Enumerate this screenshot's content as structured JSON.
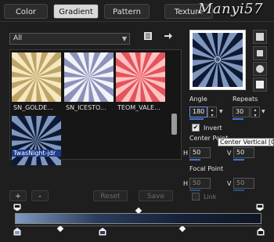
{
  "tabs": [
    {
      "label": "Color"
    },
    {
      "label": "Gradient"
    },
    {
      "label": "Pattern"
    },
    {
      "label": "Texture"
    }
  ],
  "watermark": "Manyi57",
  "category": {
    "selected": "All"
  },
  "gallery": {
    "items": [
      {
        "label": "SN_GOLDE...",
        "colors": [
          "#f5e7bf",
          "#bfa468"
        ]
      },
      {
        "label": "SN_ICESTO...",
        "colors": [
          "#f2f2f8",
          "#8c92ba"
        ]
      },
      {
        "label": "TEOM_VALE...",
        "colors": [
          "#ffc2c2",
          "#e4545c"
        ]
      },
      {
        "label": "TwasNight-jdr",
        "colors": [
          "#7f97bf",
          "#0e1a33"
        ],
        "selected": true
      }
    ]
  },
  "buttons": {
    "add": "+",
    "remove": "-",
    "reset": "Reset",
    "save": "Save"
  },
  "settings": {
    "angle_label": "Angle",
    "angle_value": "180",
    "repeats_label": "Repeats",
    "repeats_value": "30",
    "invert_label": "Invert",
    "invert_checked": true,
    "center_label": "Center Point",
    "center_h_label": "H",
    "center_h": "50",
    "center_v_label": "V",
    "center_v": "50",
    "focal_label": "Focal Point",
    "focal_h_label": "H",
    "focal_h": "50",
    "focal_v_label": "V",
    "focal_v": "50",
    "link_label": "Link",
    "link_checked": false
  },
  "tooltip": "Center Vertical [0"
}
